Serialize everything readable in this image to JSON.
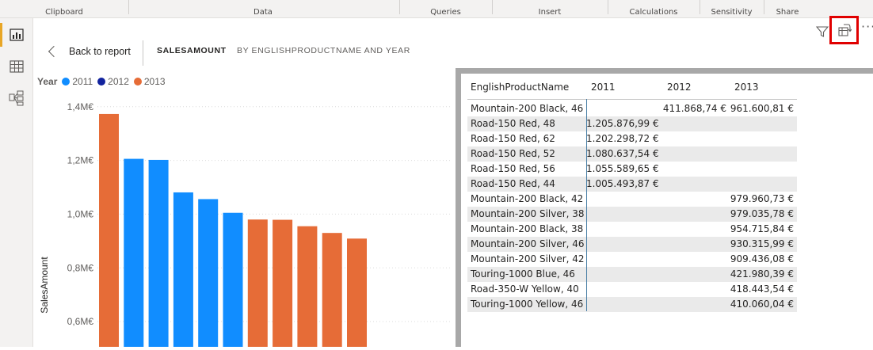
{
  "ribbon": {
    "groups": [
      "Clipboard",
      "Data",
      "Queries",
      "Insert",
      "Calculations",
      "Sensitivity",
      "Share"
    ]
  },
  "rail": {
    "icons": [
      "report-view-icon",
      "data-view-icon",
      "model-view-icon"
    ]
  },
  "header": {
    "back_label": "Back to report",
    "title_measure": "SALESAMOUNT",
    "title_by": "BY ENGLISHPRODUCTNAME AND YEAR",
    "more_label": "···"
  },
  "legend": {
    "title": "Year",
    "items": [
      {
        "label": "2011",
        "color": "#118dff"
      },
      {
        "label": "2012",
        "color": "#12239e"
      },
      {
        "label": "2013",
        "color": "#e66c37"
      }
    ]
  },
  "chart_data": {
    "type": "bar",
    "ylabel": "SalesAmount",
    "ylim": [
      0.5,
      1.42
    ],
    "yticks": [
      {
        "value": 1.4,
        "label": "1,4M€"
      },
      {
        "value": 1.2,
        "label": "1,2M€"
      },
      {
        "value": 1.0,
        "label": "1,0M€"
      },
      {
        "value": 0.8,
        "label": "0,8M€"
      },
      {
        "value": 0.6,
        "label": "0,6M€"
      }
    ],
    "bars": [
      {
        "value": 1.373,
        "year": "2013"
      },
      {
        "value": 1.206,
        "year": "2011"
      },
      {
        "value": 1.202,
        "year": "2011"
      },
      {
        "value": 1.081,
        "year": "2011"
      },
      {
        "value": 1.056,
        "year": "2011"
      },
      {
        "value": 1.005,
        "year": "2011"
      },
      {
        "value": 0.98,
        "year": "2013"
      },
      {
        "value": 0.979,
        "year": "2013"
      },
      {
        "value": 0.955,
        "year": "2013"
      },
      {
        "value": 0.93,
        "year": "2013"
      },
      {
        "value": 0.909,
        "year": "2013"
      }
    ]
  },
  "matrix": {
    "headers": [
      "EnglishProductName",
      "2011",
      "2012",
      "2013"
    ],
    "rows": [
      [
        "Mountain-200 Black, 46",
        "",
        "411.868,74 €",
        "961.600,81 €"
      ],
      [
        "Road-150 Red, 48",
        "1.205.876,99 €",
        "",
        ""
      ],
      [
        "Road-150 Red, 62",
        "1.202.298,72 €",
        "",
        ""
      ],
      [
        "Road-150 Red, 52",
        "1.080.637,54 €",
        "",
        ""
      ],
      [
        "Road-150 Red, 56",
        "1.055.589,65 €",
        "",
        ""
      ],
      [
        "Road-150 Red, 44",
        "1.005.493,87 €",
        "",
        ""
      ],
      [
        "Mountain-200 Black, 42",
        "",
        "",
        "979.960,73 €"
      ],
      [
        "Mountain-200 Silver, 38",
        "",
        "",
        "979.035,78 €"
      ],
      [
        "Mountain-200 Black, 38",
        "",
        "",
        "954.715,84 €"
      ],
      [
        "Mountain-200 Silver, 46",
        "",
        "",
        "930.315,99 €"
      ],
      [
        "Mountain-200 Silver, 42",
        "",
        "",
        "909.436,08 €"
      ],
      [
        "Touring-1000 Blue, 46",
        "",
        "",
        "421.980,39 €"
      ],
      [
        "Road-350-W Yellow, 40",
        "",
        "",
        "418.443,54 €"
      ],
      [
        "Touring-1000 Yellow, 46",
        "",
        "",
        "410.060,04 €"
      ]
    ]
  }
}
